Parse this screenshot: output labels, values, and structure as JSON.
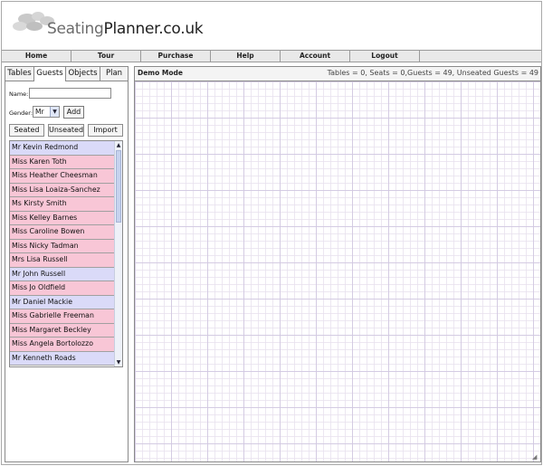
{
  "logo": {
    "text_a": "Seating",
    "text_b": "Planner.co.uk"
  },
  "nav": [
    "Home",
    "Tour",
    "Purchase",
    "Help",
    "Account",
    "Logout"
  ],
  "left_tabs": [
    "Tables",
    "Guests",
    "Objects",
    "Plan"
  ],
  "form": {
    "name_label": "Name:",
    "name_value": "",
    "gender_label": "Gender:",
    "gender_value": "Mr",
    "add_label": "Add"
  },
  "filters": [
    "Seated",
    "Unseated",
    "Import"
  ],
  "guests": [
    {
      "name": "Mr Kevin Redmond",
      "gender": "male"
    },
    {
      "name": "Miss Karen Toth",
      "gender": "female"
    },
    {
      "name": "Miss Heather Cheesman",
      "gender": "female"
    },
    {
      "name": "Miss Lisa Loaiza-Sanchez",
      "gender": "female"
    },
    {
      "name": "Ms Kirsty Smith",
      "gender": "female"
    },
    {
      "name": "Miss Kelley Barnes",
      "gender": "female"
    },
    {
      "name": "Miss Caroline Bowen",
      "gender": "female"
    },
    {
      "name": "Miss Nicky Tadman",
      "gender": "female"
    },
    {
      "name": "Mrs Lisa Russell",
      "gender": "female"
    },
    {
      "name": "Mr John Russell",
      "gender": "male"
    },
    {
      "name": "Miss Jo Oldfield",
      "gender": "female"
    },
    {
      "name": "Mr Daniel Mackie",
      "gender": "male"
    },
    {
      "name": "Miss Gabrielle Freeman",
      "gender": "female"
    },
    {
      "name": "Miss Margaret Beckley",
      "gender": "female"
    },
    {
      "name": "Miss Angela Bortolozzo",
      "gender": "female"
    },
    {
      "name": "Mr Kenneth Roads",
      "gender": "male"
    }
  ],
  "canvas": {
    "mode": "Demo Mode",
    "stats": "Tables = 0, Seats = 0,Guests = 49, Unseated Guests = 49"
  },
  "colors": {
    "male_row": "#dadaf8",
    "female_row": "#f8c6d6",
    "grid_line": "#d2c8e1"
  }
}
